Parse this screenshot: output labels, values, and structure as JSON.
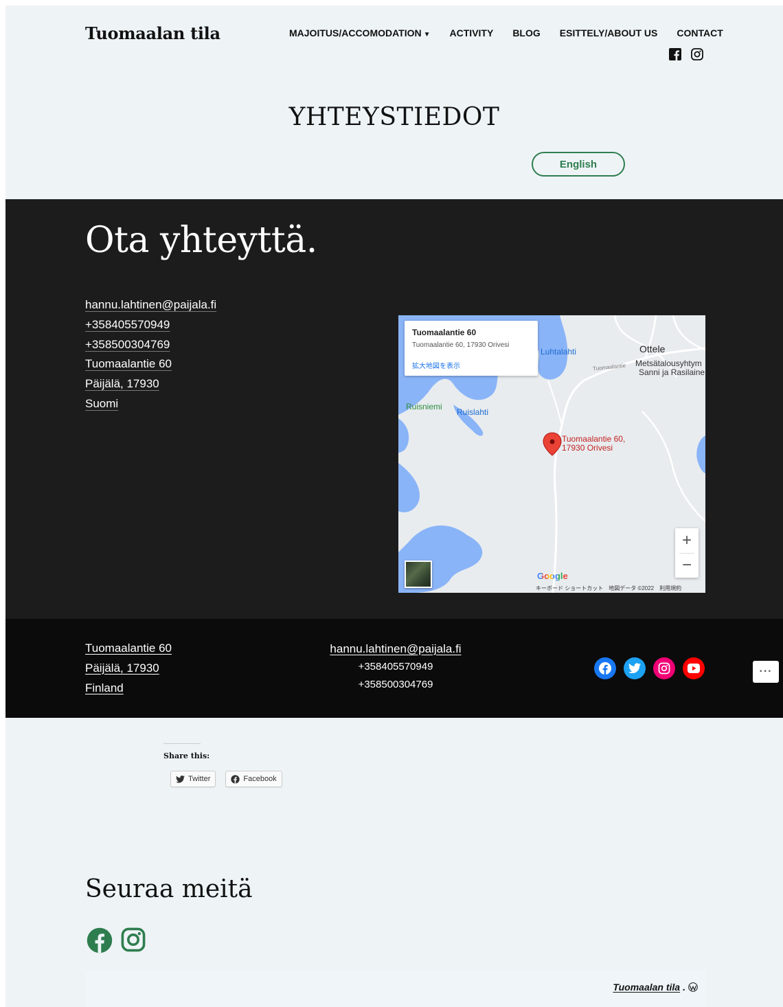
{
  "header": {
    "site_title": "Tuomaalan tila",
    "nav": [
      {
        "label": "MAJOITUS/ACCOMODATION",
        "has_dropdown": true
      },
      {
        "label": "ACTIVITY"
      },
      {
        "label": "BLOG"
      },
      {
        "label": "ESITTELY/ABOUT US"
      },
      {
        "label": "CONTACT"
      }
    ],
    "social_icons": [
      "facebook-icon",
      "instagram-icon"
    ]
  },
  "page": {
    "title": "YHTEYSTIEDOT",
    "language_button": "English"
  },
  "contact": {
    "heading": "Ota yhteyttä.",
    "lines": [
      "hannu.lahtinen@paijala.fi",
      "+358405570949",
      "+358500304769",
      "Tuomaalantie 60",
      "Päijälä, 17930",
      "Suomi"
    ]
  },
  "map": {
    "info_title": "Tuomaalantie 60",
    "info_address": "Tuomaalantie 60, 17930 Orivesi",
    "info_link": "拡大地図を表示",
    "labels": {
      "luhtalahti": "Luhtalahti",
      "ottele": "Ottele",
      "metsa1": "Metsätalousyhtym",
      "metsa2": "Sanni ja Rasilaine",
      "road": "Tuomaalantie",
      "ruisniemi": "Ruisniemi",
      "ruislahti": "Ruislahti",
      "pin1": "Tuomaalantie 60,",
      "pin2": "17930 Orivesi"
    },
    "zoom_in": "+",
    "zoom_out": "−",
    "google": "Google",
    "footer_text": "キーボード ショートカット　地図データ ©2022　利用規約",
    "colors": {
      "water": "#8ab4f8",
      "land": "#e8ecef",
      "pin": "#ea4335"
    }
  },
  "footer": {
    "address": [
      "Tuomaalantie 60",
      "Päijälä, 17930",
      "Finland"
    ],
    "email": "hannu.lahtinen@paijala.fi",
    "phones": [
      "+358405570949",
      "+358500304769"
    ],
    "social": [
      {
        "name": "facebook-icon",
        "color": "#1877f2"
      },
      {
        "name": "twitter-icon",
        "color": "#1da1f2"
      },
      {
        "name": "instagram-icon",
        "color": "#f00075"
      },
      {
        "name": "youtube-icon",
        "color": "#ff0000"
      }
    ],
    "more": "···"
  },
  "share": {
    "title": "Share this:",
    "twitter": "Twitter",
    "facebook": "Facebook"
  },
  "follow": {
    "heading": "Seuraa meitä",
    "icon_color": "#2e7d4f"
  },
  "credit": {
    "text": "Tuomaalan tila",
    "suffix": "."
  }
}
